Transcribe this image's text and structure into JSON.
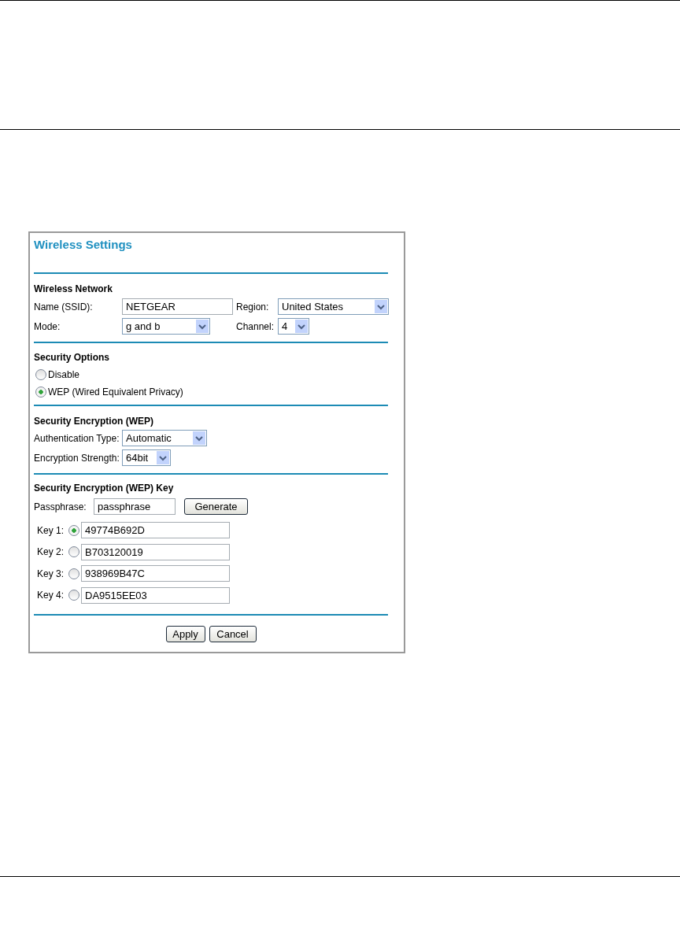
{
  "title": "Wireless Settings",
  "wireless_network": {
    "heading": "Wireless Network",
    "ssid": {
      "label": "Name (SSID):",
      "value": "NETGEAR"
    },
    "region": {
      "label": "Region:",
      "value": "United States"
    },
    "mode": {
      "label": "Mode:",
      "value": "g and b"
    },
    "channel": {
      "label": "Channel:",
      "value": "4"
    }
  },
  "security_options": {
    "heading": "Security Options",
    "options": [
      {
        "label": "Disable",
        "selected": false
      },
      {
        "label": "WEP (Wired Equivalent Privacy)",
        "selected": true
      }
    ]
  },
  "encryption": {
    "heading": "Security Encryption (WEP)",
    "fields": [
      {
        "label": "Authentication Type:",
        "value": "Automatic"
      },
      {
        "label": "Encryption Strength:",
        "value": "64bit"
      }
    ]
  },
  "wep_key": {
    "heading": "Security Encryption (WEP) Key",
    "passphrase": {
      "label": "Passphrase:",
      "value": "passphrase"
    },
    "generate": "Generate",
    "keys": [
      {
        "label": "Key 1:",
        "value": "49774B692D",
        "selected": true
      },
      {
        "label": "Key 2:",
        "value": "B703120019",
        "selected": false
      },
      {
        "label": "Key 3:",
        "value": "938969B47C",
        "selected": false
      },
      {
        "label": "Key 4:",
        "value": "DA9515EE03",
        "selected": false
      }
    ]
  },
  "buttons": [
    "Apply",
    "Cancel"
  ]
}
